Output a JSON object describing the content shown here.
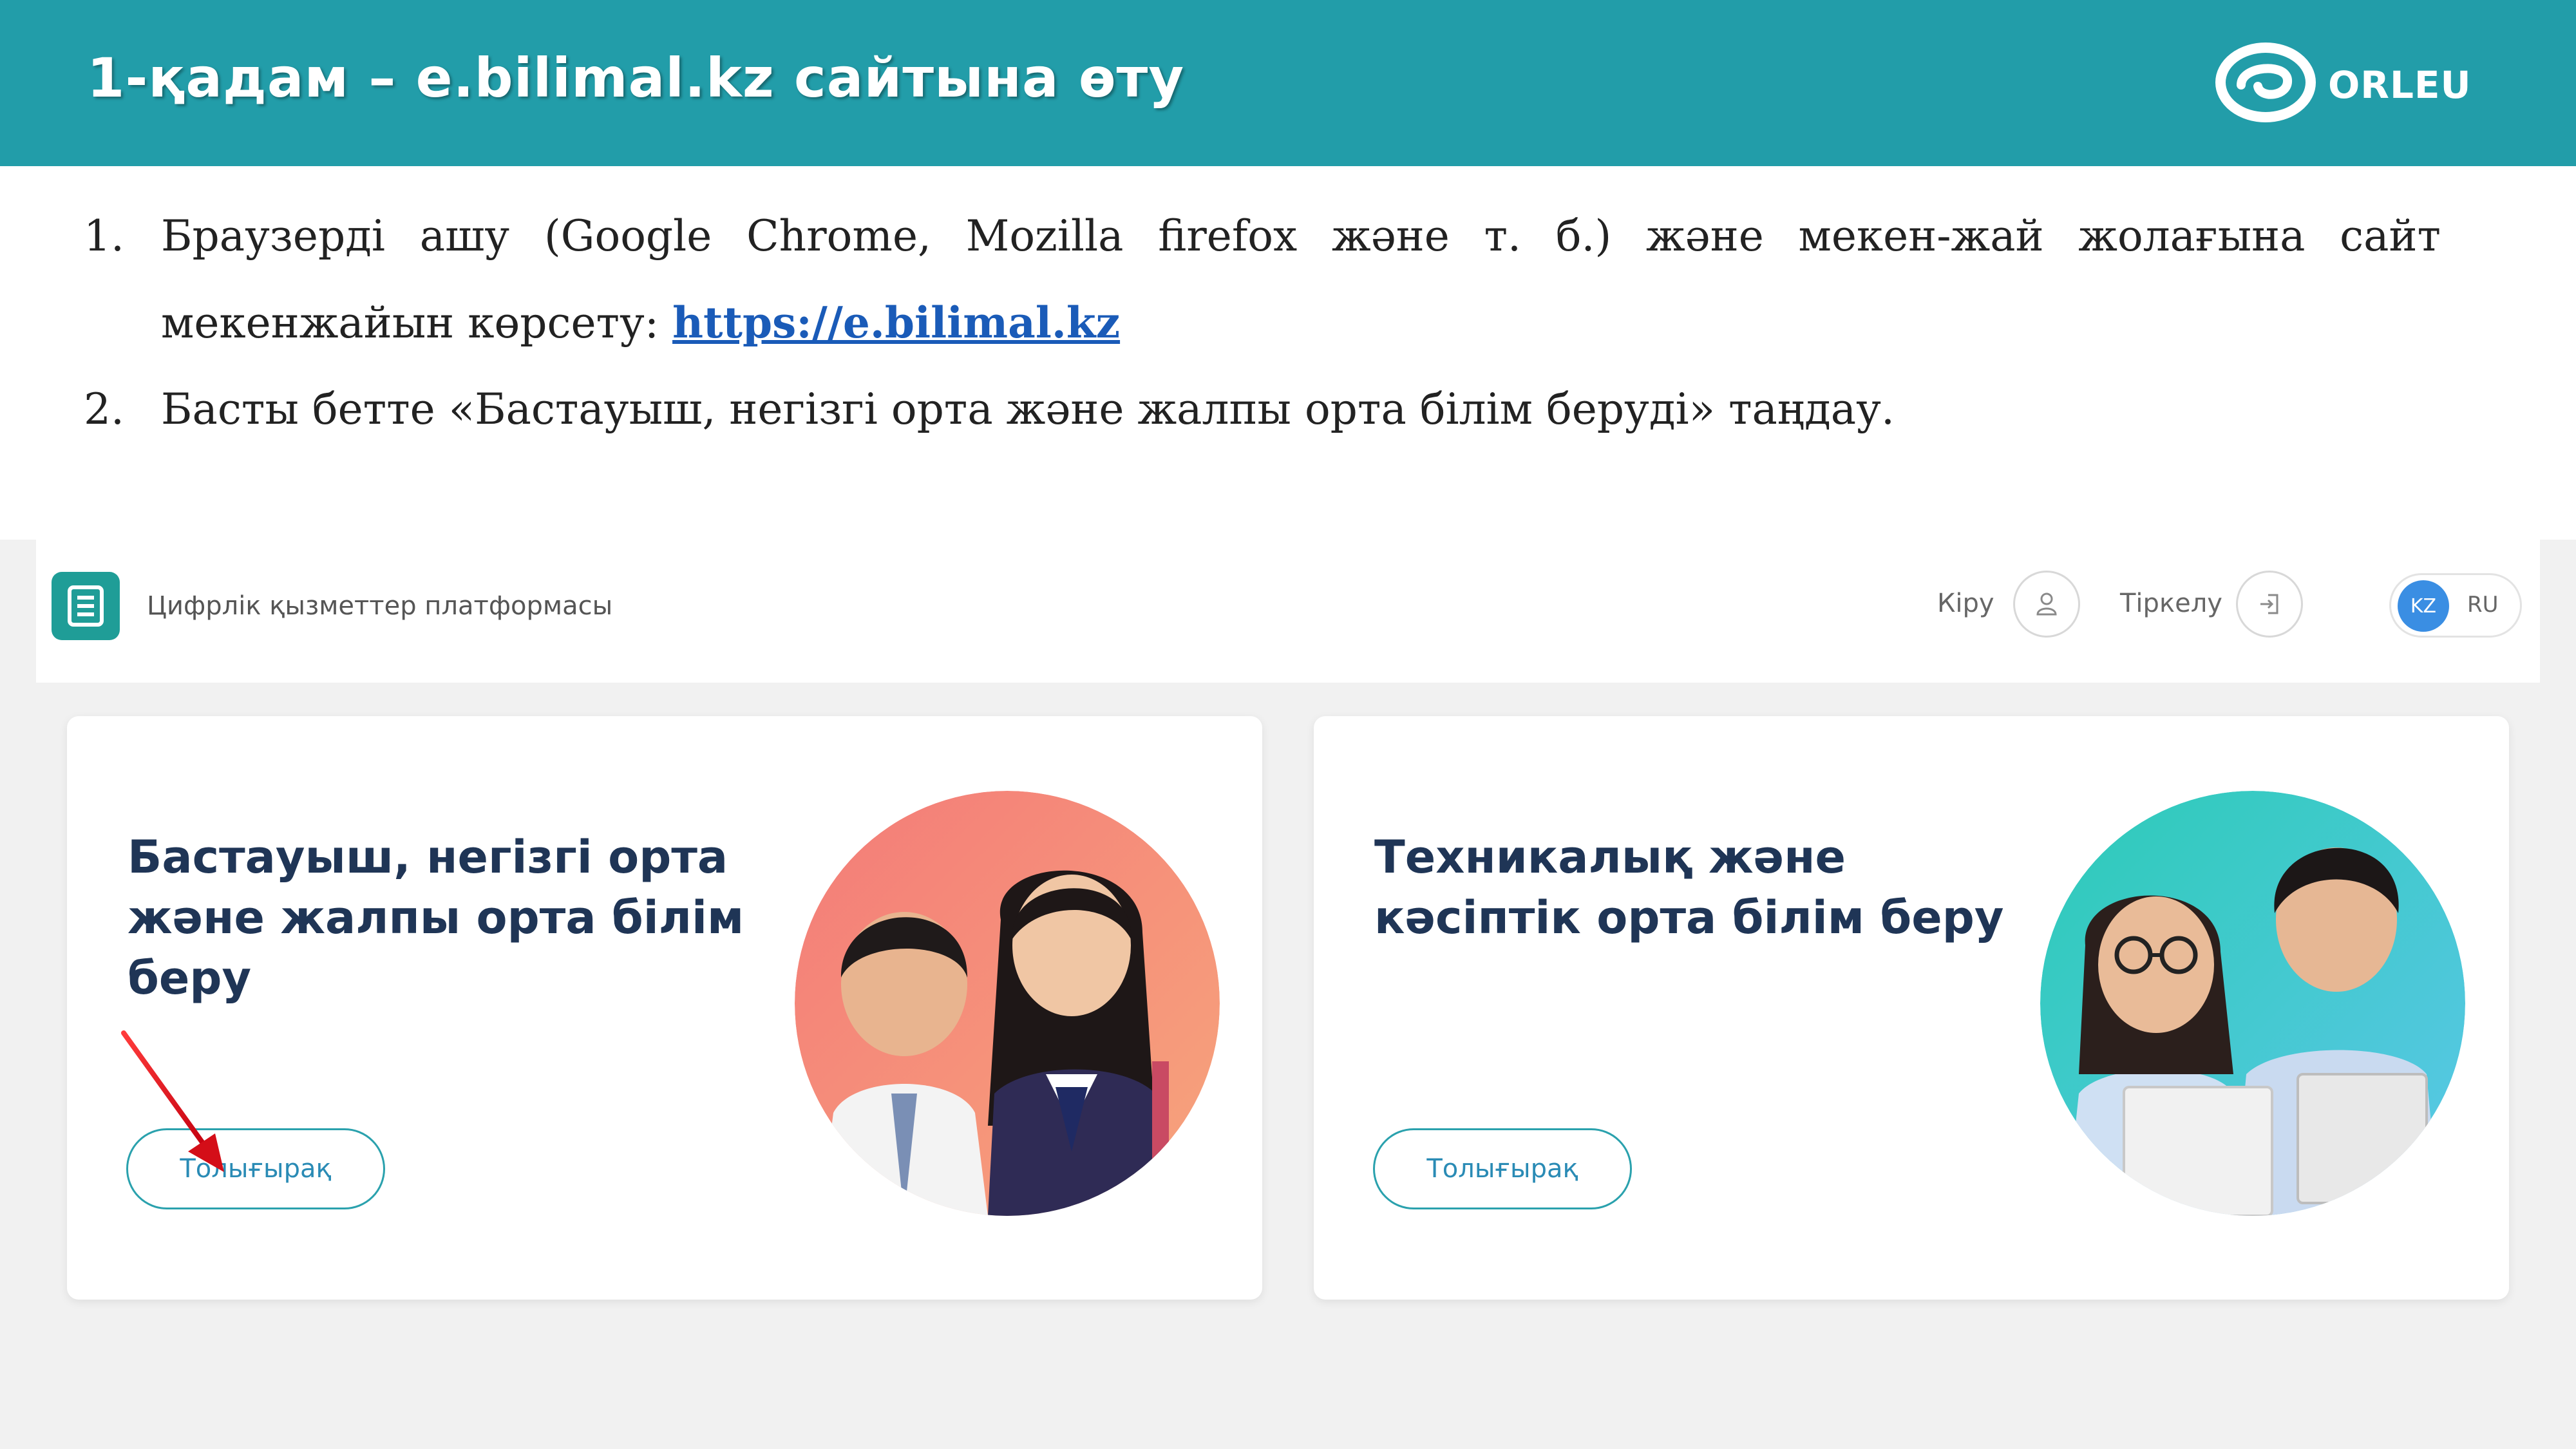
{
  "header": {
    "title": "1-қадам – e.bilimal.kz сайтына өту",
    "logo_text": "ORLEU"
  },
  "steps": [
    {
      "num": "1.",
      "text": "Браузерді ашу (Google Chrome, Mozilla firefox және т. б.) және мекен-жай жолағына сайт мекенжайын көрсету: ",
      "link": "https://e.bilimal.kz"
    },
    {
      "num": "2.",
      "text": "Басты бетте «Бастауыш, негізгі орта және жалпы орта білім беруді» таңдау."
    }
  ],
  "site": {
    "platform_name": "Цифрлік қызметтер платформасы",
    "login_label": "Кіру",
    "register_label": "Тіркелу",
    "lang_active": "KZ",
    "lang_other": "RU",
    "cards": [
      {
        "title": "Бастауыш, негізгі орта және жалпы орта білім беру",
        "button": "Толығырақ",
        "photo_bg": "#f4887a"
      },
      {
        "title": "Техникалық және кәсіптік орта білім беру",
        "button": "Толығырақ",
        "photo_bg": "#3fc9c4"
      }
    ]
  },
  "colors": {
    "header_bg": "#229da9",
    "link": "#1a5bb8",
    "accent": "#2aa1ad",
    "arrow": "#e0121b"
  }
}
